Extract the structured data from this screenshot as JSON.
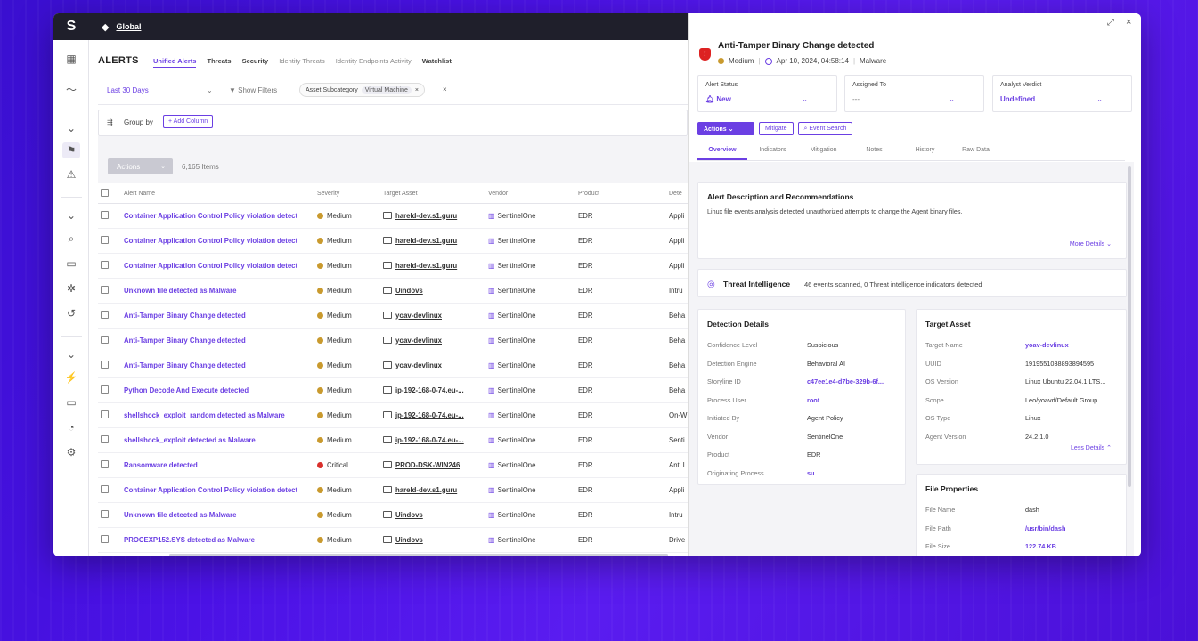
{
  "colors": {
    "accent": "#6b3fe3",
    "medium": "#c99a2e",
    "critical": "#d9302c",
    "background": "#4b12e6"
  },
  "topbar": {
    "workspace": "Global"
  },
  "header": {
    "title": "ALERTS"
  },
  "tabs": [
    {
      "label": "Unified Alerts",
      "state": "active"
    },
    {
      "label": "Threats",
      "state": "normal"
    },
    {
      "label": "Security",
      "state": "normal"
    },
    {
      "label": "Identity Threats",
      "state": "dim"
    },
    {
      "label": "Identity Endpoints Activity",
      "state": "dim"
    },
    {
      "label": "Watchlist",
      "state": "normal"
    }
  ],
  "filters": {
    "date_range": "Last 30 Days",
    "show_filters": "Show Filters",
    "chip_label": "Asset Subcategory",
    "chip_value": "Virtual Machine"
  },
  "group": {
    "label": "Group by",
    "add_column": "+ Add Column"
  },
  "toolbar": {
    "actions_label": "Actions",
    "items_count": "6,165 Items"
  },
  "table": {
    "columns": [
      "Alert Name",
      "Severity",
      "Target Asset",
      "Vendor",
      "Product",
      "Dete"
    ],
    "rows": [
      {
        "name": "Container Application Control Policy violation detect",
        "severity": "Medium",
        "asset": "hareld-dev.s1.guru",
        "vendor": "SentinelOne",
        "product": "EDR",
        "detection": "Appli"
      },
      {
        "name": "Container Application Control Policy violation detect",
        "severity": "Medium",
        "asset": "hareld-dev.s1.guru",
        "vendor": "SentinelOne",
        "product": "EDR",
        "detection": "Appli"
      },
      {
        "name": "Container Application Control Policy violation detect",
        "severity": "Medium",
        "asset": "hareld-dev.s1.guru",
        "vendor": "SentinelOne",
        "product": "EDR",
        "detection": "Appli"
      },
      {
        "name": "Unknown file detected as Malware",
        "severity": "Medium",
        "asset": "Uindovs",
        "vendor": "SentinelOne",
        "product": "EDR",
        "detection": "Intru"
      },
      {
        "name": "Anti-Tamper Binary Change detected",
        "severity": "Medium",
        "asset": "yoav-devlinux",
        "vendor": "SentinelOne",
        "product": "EDR",
        "detection": "Beha"
      },
      {
        "name": "Anti-Tamper Binary Change detected",
        "severity": "Medium",
        "asset": "yoav-devlinux",
        "vendor": "SentinelOne",
        "product": "EDR",
        "detection": "Beha"
      },
      {
        "name": "Anti-Tamper Binary Change detected",
        "severity": "Medium",
        "asset": "yoav-devlinux",
        "vendor": "SentinelOne",
        "product": "EDR",
        "detection": "Beha"
      },
      {
        "name": "Python Decode And Execute detected",
        "severity": "Medium",
        "asset": "ip-192-168-0-74.eu-...",
        "vendor": "SentinelOne",
        "product": "EDR",
        "detection": "Beha"
      },
      {
        "name": "shellshock_exploit_random detected as Malware",
        "severity": "Medium",
        "asset": "ip-192-168-0-74.eu-...",
        "vendor": "SentinelOne",
        "product": "EDR",
        "detection": "On-W"
      },
      {
        "name": "shellshock_exploit detected as Malware",
        "severity": "Medium",
        "asset": "ip-192-168-0-74.eu-...",
        "vendor": "SentinelOne",
        "product": "EDR",
        "detection": "Senti"
      },
      {
        "name": "Ransomware detected",
        "severity": "Critical",
        "asset": "PROD-DSK-WIN246",
        "vendor": "SentinelOne",
        "product": "EDR",
        "detection": "Anti I"
      },
      {
        "name": "Container Application Control Policy violation detect",
        "severity": "Medium",
        "asset": "hareld-dev.s1.guru",
        "vendor": "SentinelOne",
        "product": "EDR",
        "detection": "Appli"
      },
      {
        "name": "Unknown file detected as Malware",
        "severity": "Medium",
        "asset": "Uindovs",
        "vendor": "SentinelOne",
        "product": "EDR",
        "detection": "Intru"
      },
      {
        "name": "PROCEXP152.SYS detected as Malware",
        "severity": "Medium",
        "asset": "Uindovs",
        "vendor": "SentinelOne",
        "product": "EDR",
        "detection": "Drive"
      }
    ]
  },
  "panel": {
    "title": "Anti-Tamper Binary Change detected",
    "severity": "Medium",
    "timestamp": "Apr 10, 2024, 04:58:14",
    "category": "Malware",
    "fields": [
      {
        "label": "Alert Status",
        "value": "New",
        "icon": "bell-icon"
      },
      {
        "label": "Assigned To",
        "value": "---"
      },
      {
        "label": "Analyst Verdict",
        "value": "Undefined"
      }
    ],
    "buttons": {
      "actions": "Actions",
      "mitigate": "Mitigate",
      "event_search": "Event Search"
    },
    "tabs": [
      "Overview",
      "Indicators",
      "Mitigation",
      "Notes",
      "History",
      "Raw Data"
    ],
    "description": {
      "title": "Alert Description and Recommendations",
      "text": "Linux file events analysis detected unauthorized attempts to change the Agent binary files.",
      "more": "More Details"
    },
    "threat_intel": {
      "title": "Threat Intelligence",
      "text": "46 events scanned, 0 Threat intelligence indicators detected"
    },
    "detection": {
      "title": "Detection Details",
      "rows": [
        {
          "k": "Confidence Level",
          "v": "Suspicious",
          "link": false
        },
        {
          "k": "Detection Engine",
          "v": "Behavioral AI",
          "link": false
        },
        {
          "k": "Storyline ID",
          "v": "c47ee1e4-d7be-329b-6f...",
          "link": true
        },
        {
          "k": "Process User",
          "v": "root",
          "link": true
        },
        {
          "k": "Initiated By",
          "v": "Agent Policy",
          "link": false
        },
        {
          "k": "Vendor",
          "v": "SentinelOne",
          "link": false
        },
        {
          "k": "Product",
          "v": "EDR",
          "link": false
        },
        {
          "k": "Originating Process",
          "v": "su",
          "link": true
        }
      ]
    },
    "target": {
      "title": "Target Asset",
      "rows": [
        {
          "k": "Target Name",
          "v": "yoav-devlinux",
          "link": true
        },
        {
          "k": "UUID",
          "v": "1919551038893894595",
          "link": false
        },
        {
          "k": "OS Version",
          "v": "Linux Ubuntu 22.04.1 LTS...",
          "link": false
        },
        {
          "k": "Scope",
          "v": "Leo/yoavd/Default Group",
          "link": false
        },
        {
          "k": "OS Type",
          "v": "Linux",
          "link": false
        },
        {
          "k": "Agent Version",
          "v": "24.2.1.0",
          "link": false
        }
      ],
      "less": "Less Details"
    },
    "file": {
      "title": "File Properties",
      "rows": [
        {
          "k": "File Name",
          "v": "dash",
          "link": false
        },
        {
          "k": "File Path",
          "v": "/usr/bin/dash",
          "link": true
        },
        {
          "k": "File Size",
          "v": "122.74 KB",
          "link": true
        }
      ]
    }
  }
}
